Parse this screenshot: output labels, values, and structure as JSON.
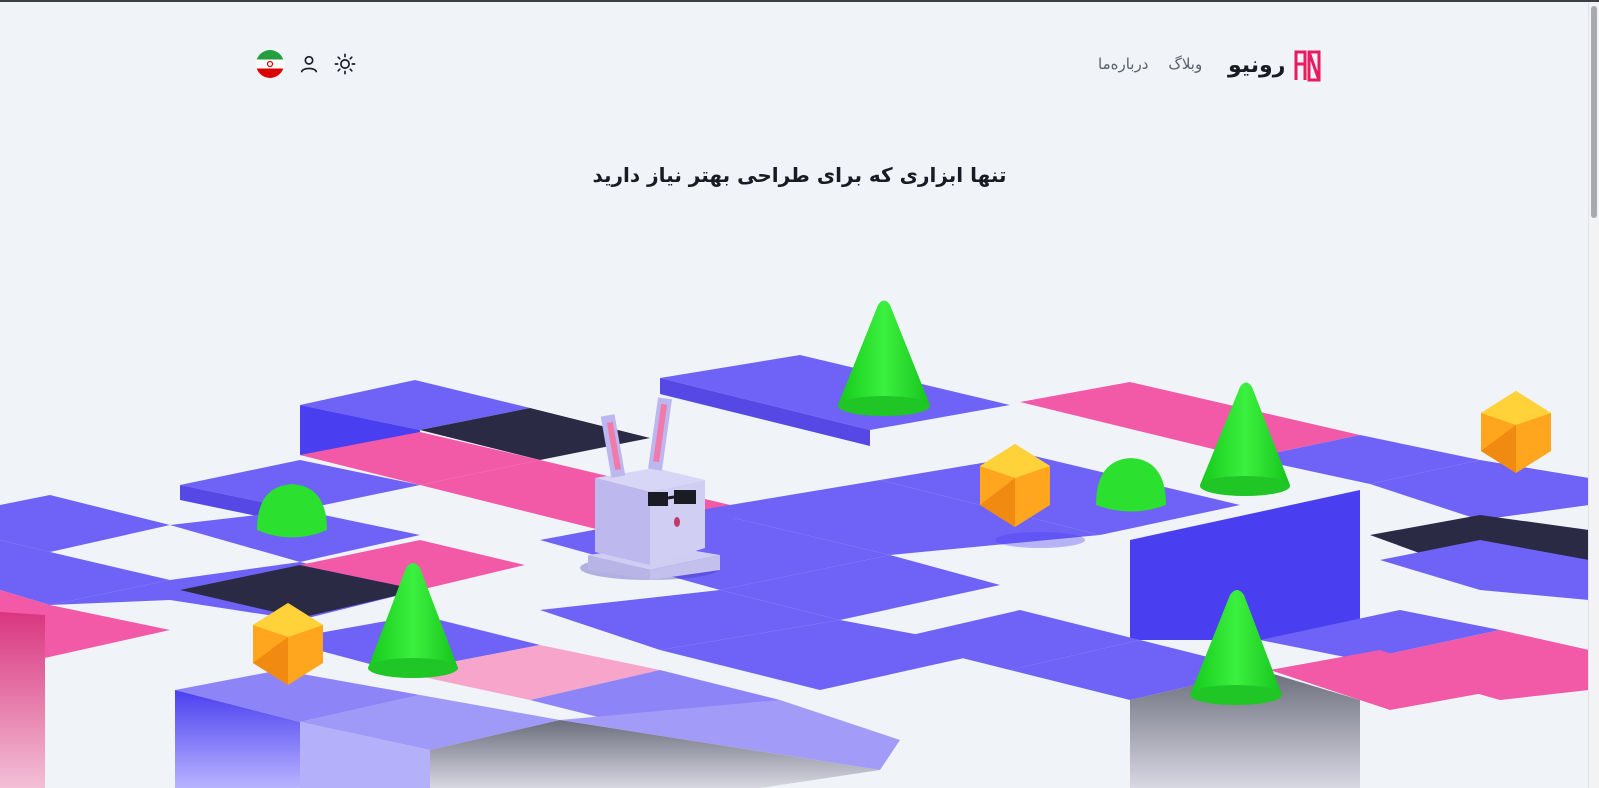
{
  "header": {
    "brand_name": "رونیو",
    "nav": [
      {
        "label": "وبلاگ"
      },
      {
        "label": "درباره‌ما"
      }
    ],
    "icons": [
      "iran-flag-icon",
      "user-icon",
      "sun-icon"
    ]
  },
  "hero": {
    "title": "تنها ابزاری که برای طراحی بهتر نیاز دارید"
  },
  "colors": {
    "background": "#f0f3f8",
    "brand": "#e81b5e",
    "tile_purple": "#6655f0",
    "tile_pink": "#f25aa8",
    "tile_dark": "#2b2a45",
    "cone_green": "#22e628",
    "gem_orange": "#ffa51e"
  }
}
